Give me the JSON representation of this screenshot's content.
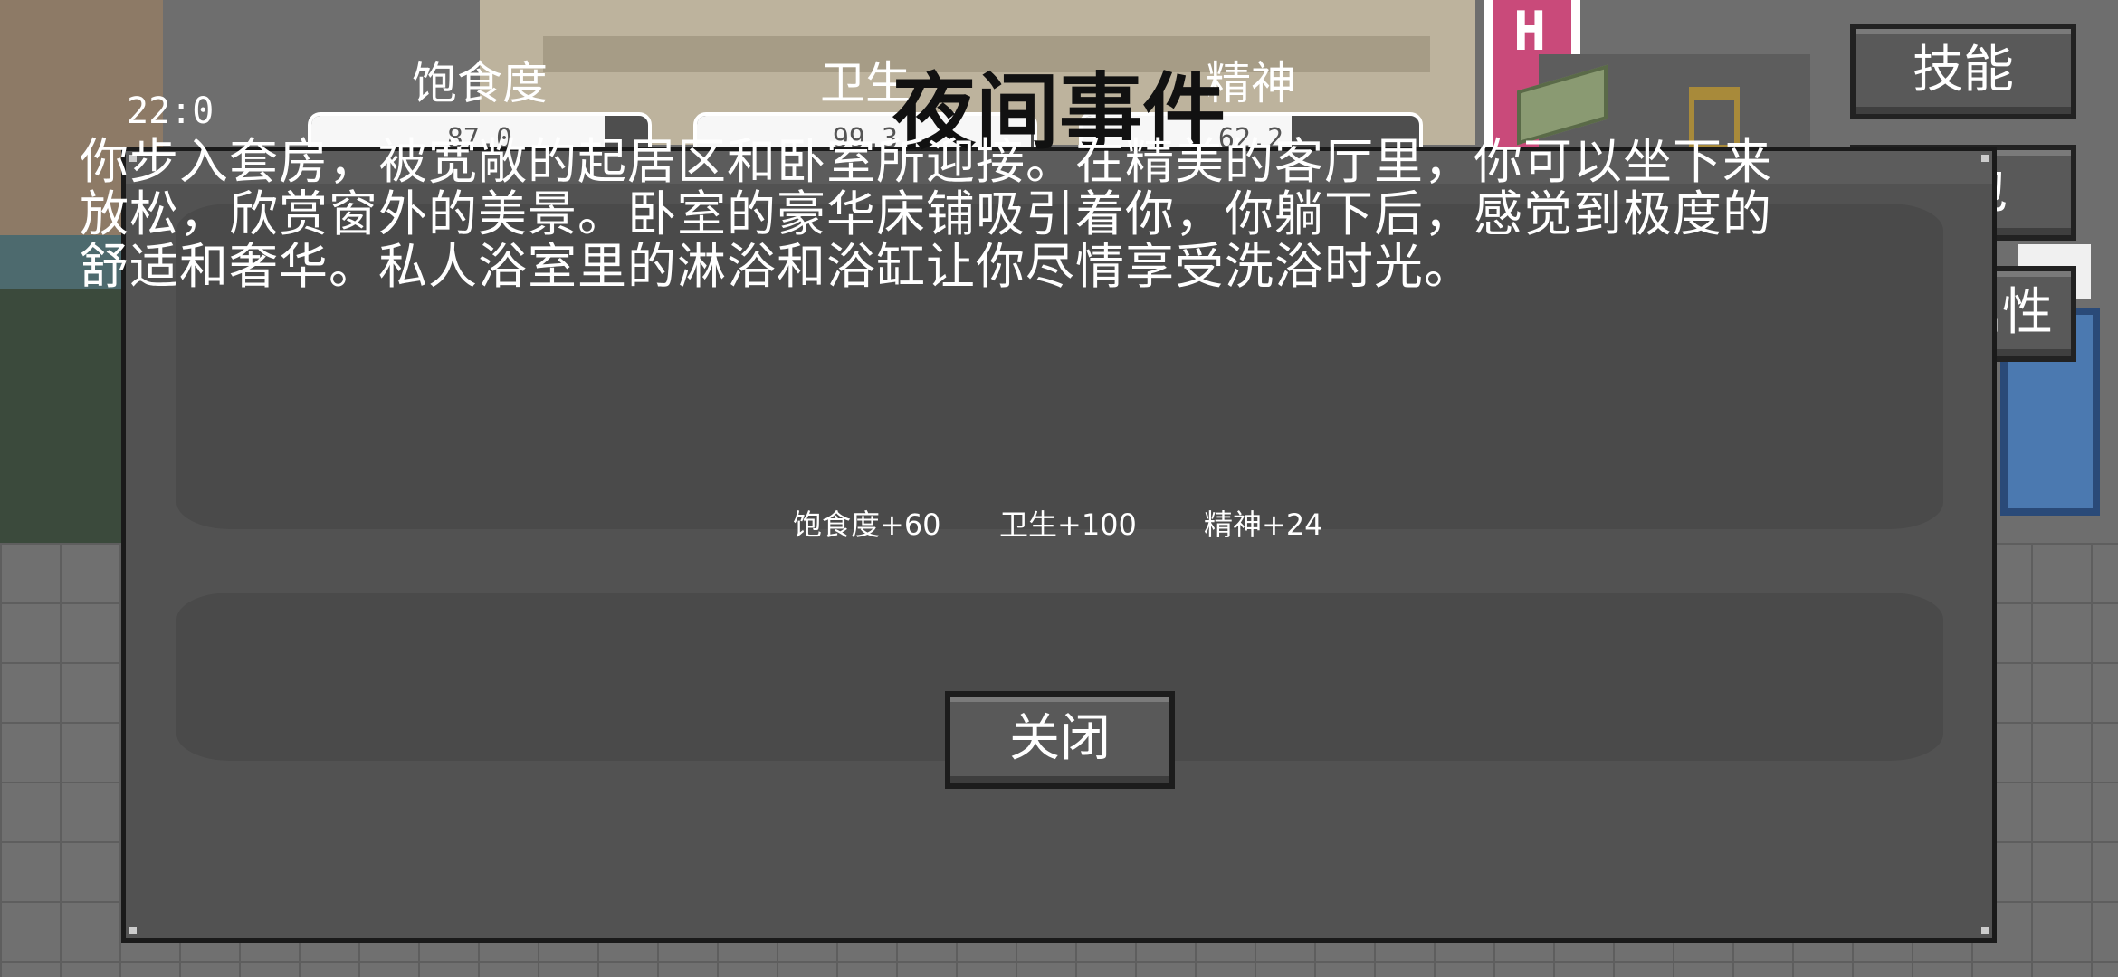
{
  "hud": {
    "time": "22:0",
    "stats": [
      {
        "label": "饱食度",
        "value": "87.0",
        "fraction": 0.87
      },
      {
        "label": "卫生",
        "value": "99.3",
        "fraction": 0.993
      },
      {
        "label": "精神",
        "value": "62.2",
        "fraction": 0.622
      }
    ]
  },
  "side_buttons": {
    "skills": "技能",
    "bag": "包",
    "attributes": "属性"
  },
  "background": {
    "hotel_sign_letter": "H"
  },
  "modal": {
    "title": "夜间事件",
    "description": "你步入套房，被宽敞的起居区和卧室所迎接。在精美的客厅里，你可以坐下来放松，欣赏窗外的美景。卧室的豪华床铺吸引着你，你躺下后，感觉到极度的舒适和奢华。私人浴室里的淋浴和浴缸让你尽情享受洗浴时光。",
    "effects": [
      "饱食度+60",
      "卫生+100",
      "精神+24"
    ],
    "close_label": "关闭"
  },
  "colors": {
    "modal_bg": "#525252",
    "panel_bg": "#4a4a4a",
    "button_bg": "#595959",
    "hotel_sign": "#c94a7a",
    "door": "#4b79b0"
  }
}
